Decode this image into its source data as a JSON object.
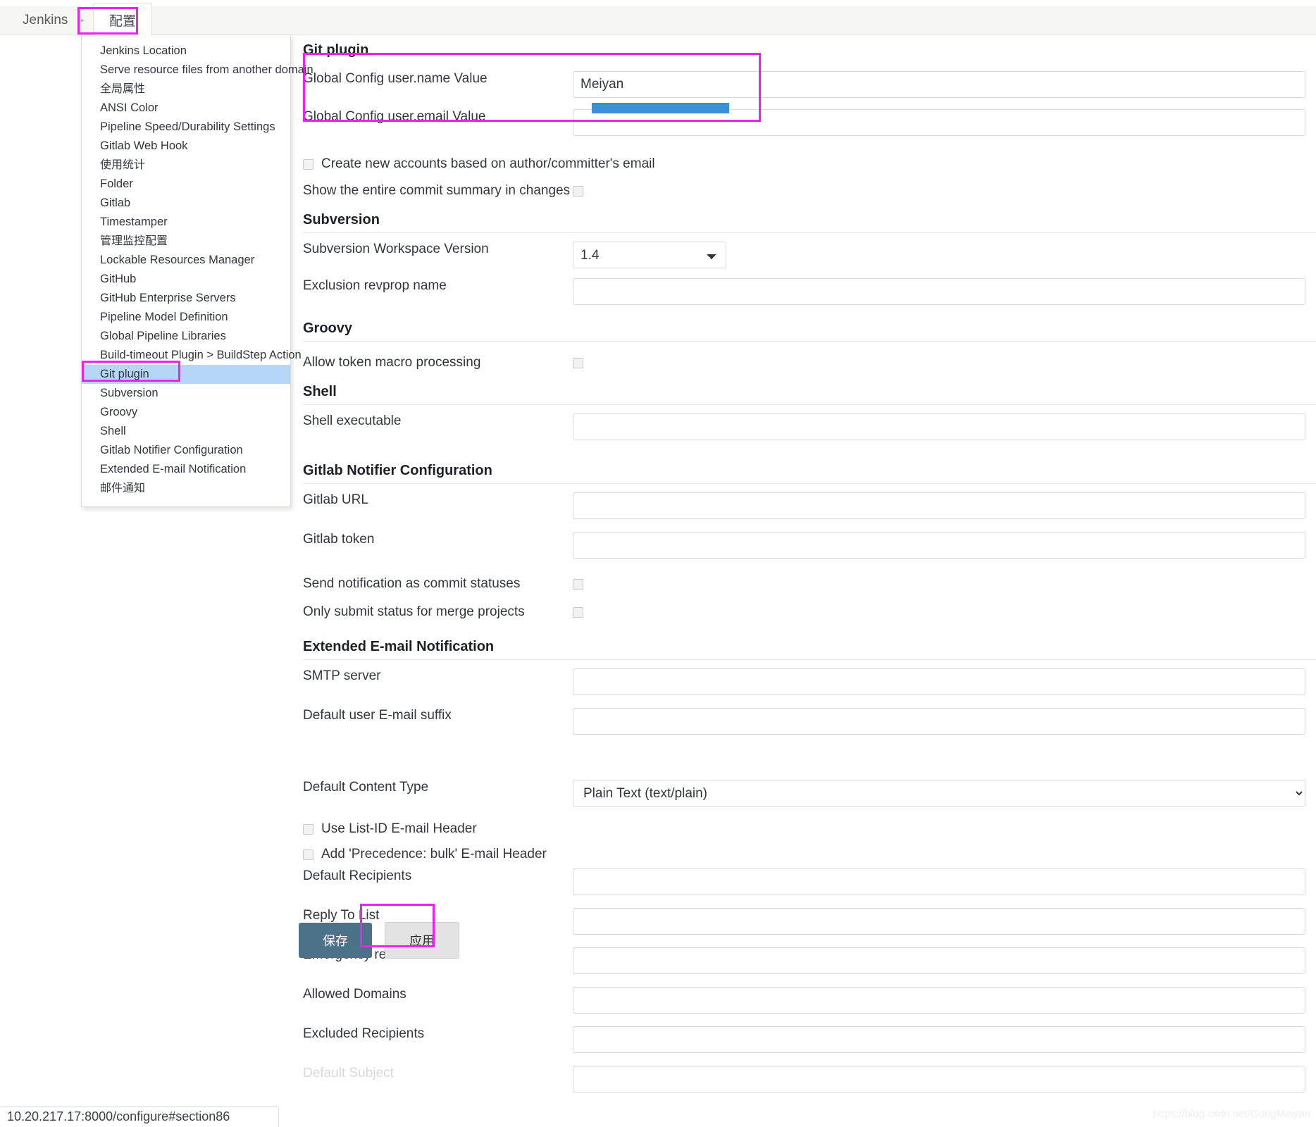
{
  "breadcrumb": {
    "root": "Jenkins",
    "separator": "▸",
    "current": "配置"
  },
  "menu": {
    "items": [
      "Jenkins Location",
      "Serve resource files from another domain",
      "全局属性",
      "ANSI Color",
      "Pipeline Speed/Durability Settings",
      "Gitlab Web Hook",
      "使用统计",
      "Folder",
      "Gitlab",
      "Timestamper",
      "管理监控配置",
      "Lockable Resources Manager",
      "GitHub",
      "GitHub Enterprise Servers",
      "Pipeline Model Definition",
      "Global Pipeline Libraries",
      "Build-timeout Plugin > BuildStep Action",
      "Git plugin",
      "Subversion",
      "Groovy",
      "Shell",
      "Gitlab Notifier Configuration",
      "Extended E-mail Notification",
      "邮件通知"
    ],
    "selected_index": 17
  },
  "sections": {
    "git": {
      "title": "Git plugin",
      "username_label": "Global Config user.name Value",
      "username_value": "Meiyan",
      "email_label": "Global Config user.email Value",
      "email_value": "",
      "create_accounts_label": "Create new accounts based on author/committer's email",
      "show_commit_summary_label": "Show the entire commit summary in changes"
    },
    "subversion": {
      "title": "Subversion",
      "workspace_version_label": "Subversion Workspace Version",
      "workspace_version_value": "1.4",
      "exclusion_revprop_label": "Exclusion revprop name",
      "exclusion_revprop_value": ""
    },
    "groovy": {
      "title": "Groovy",
      "token_macro_label": "Allow token macro processing"
    },
    "shell": {
      "title": "Shell",
      "executable_label": "Shell executable",
      "executable_value": ""
    },
    "gitlab_notifier": {
      "title": "Gitlab Notifier Configuration",
      "url_label": "Gitlab URL",
      "url_value": "",
      "token_label": "Gitlab token",
      "token_value": "",
      "commit_statuses_label": "Send notification as commit statuses",
      "merge_projects_label": "Only submit status for merge projects"
    },
    "extended_email": {
      "title": "Extended E-mail Notification",
      "smtp_server_label": "SMTP server",
      "smtp_server_value": "",
      "email_suffix_label": "Default user E-mail suffix",
      "email_suffix_value": "",
      "content_type_label": "Default Content Type",
      "content_type_value": "Plain Text (text/plain)",
      "list_id_label": "Use List-ID E-mail Header",
      "precedence_label": "Add 'Precedence: bulk' E-mail Header",
      "default_recipients_label": "Default Recipients",
      "default_recipients_value": "",
      "reply_to_label": "Reply To List",
      "reply_to_value": "",
      "emergency_reroute_label": "Emergency reroute",
      "emergency_reroute_value": "",
      "allowed_domains_label": "Allowed Domains",
      "allowed_domains_value": "",
      "excluded_recipients_label": "Excluded Recipients",
      "excluded_recipients_value": "",
      "default_subject_label": "Default Subject"
    }
  },
  "footer": {
    "save_label": "保存",
    "apply_label": "应用"
  },
  "statusbar": {
    "url": "10.20.217.17:8000/configure#section86"
  },
  "watermark": {
    "text": "https://blog.csdn.net/GongMeiyan"
  },
  "colors": {
    "highlight": "#ee22ee",
    "selected_menu": "#b6d6f7",
    "save_button": "#4b7289",
    "redaction": "#3b8fd4"
  }
}
